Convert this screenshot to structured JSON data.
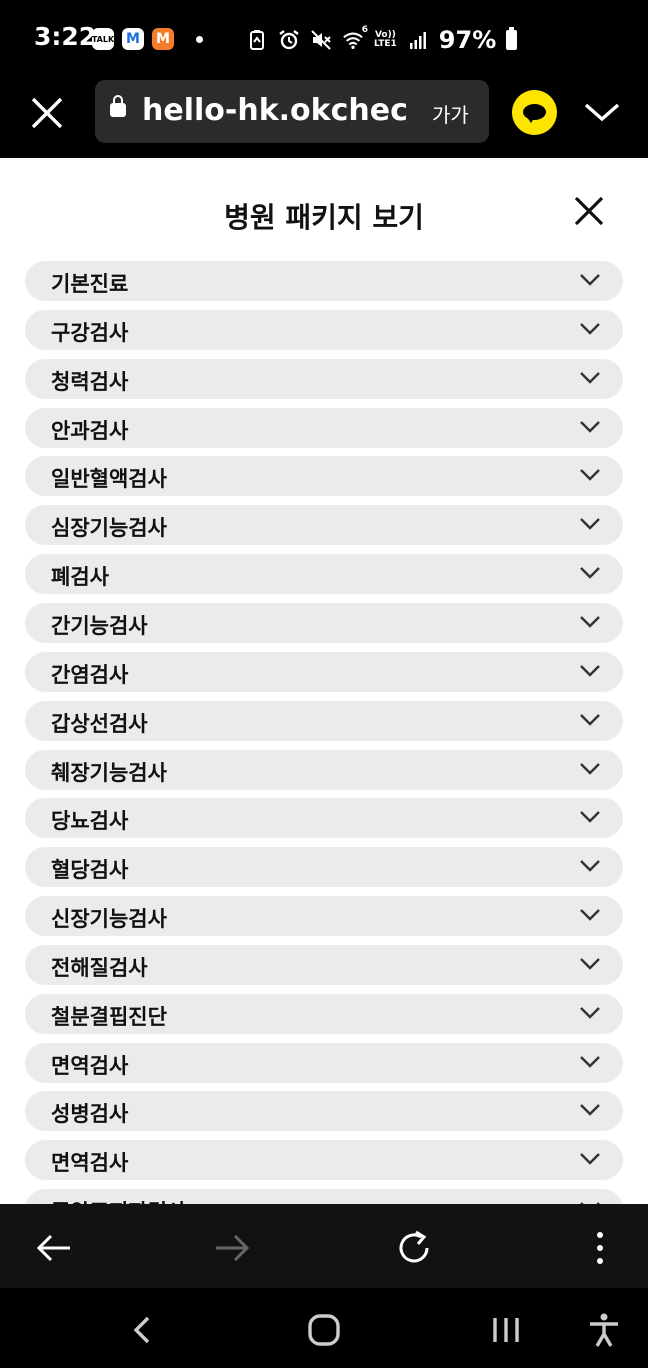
{
  "status_bar": {
    "time": "3:22",
    "badge_talk": "TALK",
    "badge_m1": "M",
    "badge_m2": "M",
    "lte_top": "Vo))",
    "lte_bottom": "LTE1",
    "wifi_sup": "6",
    "battery": "97%"
  },
  "browser": {
    "url": "hello-hk.okcheckup",
    "text_size_label": "가가"
  },
  "sheet": {
    "title": "병원 패키지 보기",
    "items": [
      "기본진료",
      "구강검사",
      "청력검사",
      "안과검사",
      "일반혈액검사",
      "심장기능검사",
      "폐검사",
      "간기능검사",
      "간염검사",
      "갑상선검사",
      "췌장기능검사",
      "당뇨검사",
      "혈당검사",
      "신장기능검사",
      "전해질검사",
      "철분결핍진단",
      "면역검사",
      "성병검사",
      "면역검사",
      "종양표지자검사"
    ]
  },
  "colors": {
    "accent_kakao": "#FEE500",
    "item_bg": "#EBEBEB",
    "toolbar_bg": "#000000",
    "url_bg": "#2B2B2B"
  }
}
